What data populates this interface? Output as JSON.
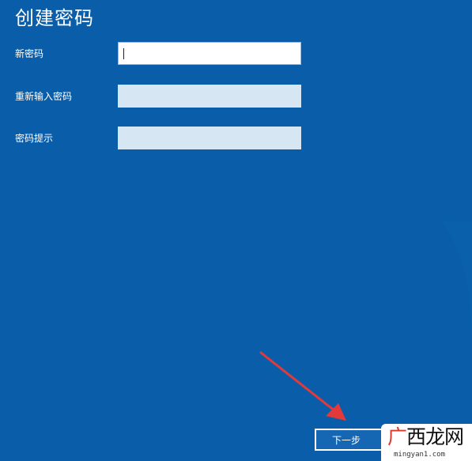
{
  "page": {
    "title": "创建密码"
  },
  "form": {
    "fields": [
      {
        "label": "新密码",
        "value": "",
        "state": "focused"
      },
      {
        "label": "重新输入密码",
        "value": "",
        "state": "inactive"
      },
      {
        "label": "密码提示",
        "value": "",
        "state": "inactive"
      }
    ]
  },
  "footer": {
    "next_label": "下一步"
  },
  "watermark": {
    "brand_first": "广",
    "brand_rest": "西龙网",
    "url": "mingyan1.com"
  },
  "colors": {
    "background": "#0a5ea9",
    "arrow": "#e23a3a",
    "input_focused": "#ffffff",
    "input_inactive": "#d6e6f2"
  }
}
